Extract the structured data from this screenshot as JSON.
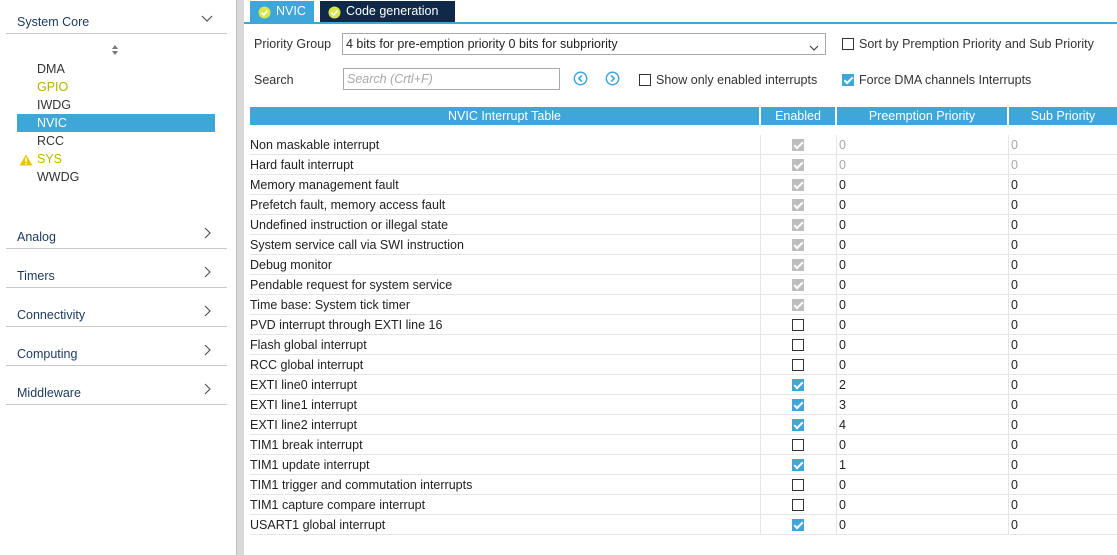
{
  "sidebar": {
    "system_core": {
      "label": "System Core",
      "items": [
        {
          "label": "DMA",
          "state": "normal"
        },
        {
          "label": "GPIO",
          "state": "configured"
        },
        {
          "label": "IWDG",
          "state": "normal"
        },
        {
          "label": "NVIC",
          "state": "selected"
        },
        {
          "label": "RCC",
          "state": "normal"
        },
        {
          "label": "SYS",
          "state": "warning"
        },
        {
          "label": "WWDG",
          "state": "normal"
        }
      ]
    },
    "categories": [
      {
        "label": "Analog"
      },
      {
        "label": "Timers"
      },
      {
        "label": "Connectivity"
      },
      {
        "label": "Computing"
      },
      {
        "label": "Middleware"
      }
    ]
  },
  "tabs": [
    {
      "label": "NVIC",
      "active": true
    },
    {
      "label": "Code generation",
      "active": false
    }
  ],
  "controls": {
    "priority_group_label": "Priority Group",
    "priority_group_value": "4 bits for pre-emption priority 0 bits for subpriority",
    "sort_label": "Sort by Premption Priority and Sub Priority",
    "sort_checked": false,
    "search_label": "Search",
    "search_placeholder": "Search (Crtl+F)",
    "show_enabled_label": "Show only enabled interrupts",
    "show_enabled_checked": false,
    "force_dma_label": "Force DMA channels Interrupts",
    "force_dma_checked": true
  },
  "table": {
    "headers": [
      "NVIC Interrupt Table",
      "Enabled",
      "Preemption Priority",
      "Sub Priority"
    ],
    "rows": [
      {
        "name": "Non maskable interrupt",
        "enabled": true,
        "locked": true,
        "preemption": "0",
        "sub": "0",
        "dim": true
      },
      {
        "name": "Hard fault interrupt",
        "enabled": true,
        "locked": true,
        "preemption": "0",
        "sub": "0",
        "dim": true
      },
      {
        "name": "Memory management fault",
        "enabled": true,
        "locked": true,
        "preemption": "0",
        "sub": "0",
        "dim": false
      },
      {
        "name": "Prefetch fault, memory access fault",
        "enabled": true,
        "locked": true,
        "preemption": "0",
        "sub": "0",
        "dim": false
      },
      {
        "name": "Undefined instruction or illegal state",
        "enabled": true,
        "locked": true,
        "preemption": "0",
        "sub": "0",
        "dim": false
      },
      {
        "name": "System service call via SWI instruction",
        "enabled": true,
        "locked": true,
        "preemption": "0",
        "sub": "0",
        "dim": false
      },
      {
        "name": "Debug monitor",
        "enabled": true,
        "locked": true,
        "preemption": "0",
        "sub": "0",
        "dim": false
      },
      {
        "name": "Pendable request for system service",
        "enabled": true,
        "locked": true,
        "preemption": "0",
        "sub": "0",
        "dim": false
      },
      {
        "name": "Time base: System tick timer",
        "enabled": true,
        "locked": true,
        "preemption": "0",
        "sub": "0",
        "dim": false
      },
      {
        "name": "PVD interrupt through EXTI line 16",
        "enabled": false,
        "locked": false,
        "preemption": "0",
        "sub": "0",
        "dim": false
      },
      {
        "name": "Flash global interrupt",
        "enabled": false,
        "locked": false,
        "preemption": "0",
        "sub": "0",
        "dim": false
      },
      {
        "name": "RCC global interrupt",
        "enabled": false,
        "locked": false,
        "preemption": "0",
        "sub": "0",
        "dim": false
      },
      {
        "name": "EXTI line0 interrupt",
        "enabled": true,
        "locked": false,
        "preemption": "2",
        "sub": "0",
        "dim": false
      },
      {
        "name": "EXTI line1 interrupt",
        "enabled": true,
        "locked": false,
        "preemption": "3",
        "sub": "0",
        "dim": false
      },
      {
        "name": "EXTI line2 interrupt",
        "enabled": true,
        "locked": false,
        "preemption": "4",
        "sub": "0",
        "dim": false
      },
      {
        "name": "TIM1 break interrupt",
        "enabled": false,
        "locked": false,
        "preemption": "0",
        "sub": "0",
        "dim": false
      },
      {
        "name": "TIM1 update interrupt",
        "enabled": true,
        "locked": false,
        "preemption": "1",
        "sub": "0",
        "dim": false
      },
      {
        "name": "TIM1 trigger and commutation interrupts",
        "enabled": false,
        "locked": false,
        "preemption": "0",
        "sub": "0",
        "dim": false
      },
      {
        "name": "TIM1 capture compare interrupt",
        "enabled": false,
        "locked": false,
        "preemption": "0",
        "sub": "0",
        "dim": false
      },
      {
        "name": "USART1 global interrupt",
        "enabled": true,
        "locked": false,
        "preemption": "0",
        "sub": "0",
        "dim": false
      }
    ]
  },
  "colors": {
    "accent": "#3ea6d8",
    "tab_dark": "#0e2a48",
    "warning": "#e8c400",
    "configured": "#b3b300"
  }
}
